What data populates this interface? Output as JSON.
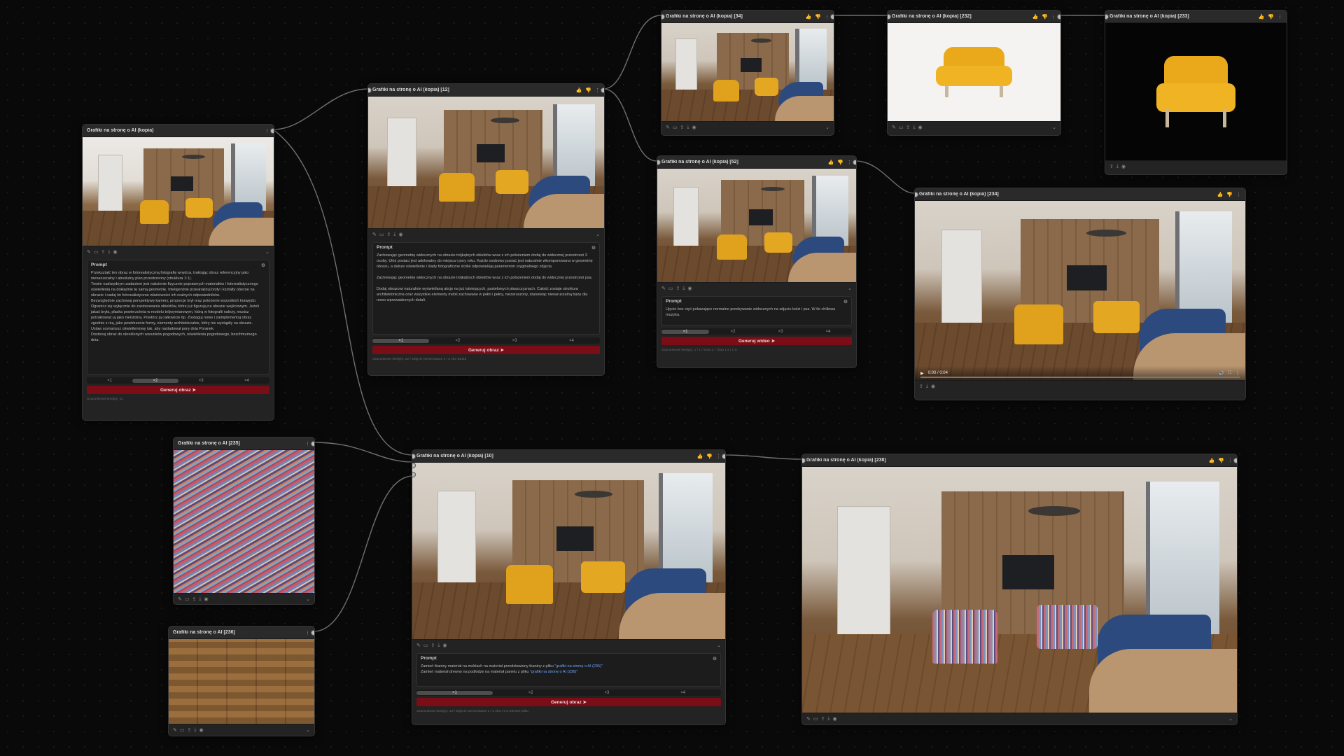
{
  "nodes": {
    "n1": {
      "title": "Grafiki na stronę o AI (kopia)",
      "prompt_label": "Prompt",
      "prompt_text": "Przekształć ten obraz w fotorealistyczną fotografię wnętrza, traktując obraz referencyjny jako nienaruszalny i absolutny plan przestrzenny (struktura 1:1).\nTwoim nadrzędnym zadaniem jest nałożenie fizycznie poprawnych materiałów i fotorealistycznego oświetlenia na dokładnie tę samą geometrię. Inteligentnie przeanalizuj bryły i kształty obecne na obrazie i nadaj im fotorealistyczne właściwości ich realnych odpowiedników.\nBezwzględnie zachowaj perspektywę kamery, proporcje brył oraz położenie wszystkich krawędzi. Ogranicz się wyłącznie do zastosowania obiektów, które już figurują na obrazie wejściowym. Jeżeli jakaś bryła, płaska powierzchnia w modelu trójwymiarowym, którą w fotografii należy, musisz potraktować ją jako nieistotną. Powtórz ją całkowicie itp. Zredaguj nowe i zaimplementuj obraz zgodnie z nią, jako powtórzenie formy, elementy architekturalne, który nie wystąpiły na obrazie.\nUstaw scenariusz oświetleniowy tak, aby naśladował porę dnia Poranek.\nDostosuj obraz do określonych warunków pogodowych, oświetlenia pogodowego, bezchmurnego dnia.",
      "counts": [
        "×1",
        "×2",
        "×3",
        "×4"
      ],
      "selected": 1,
      "gen_label": "Generuj obraz",
      "footer": "Szacunkowe kredyty: 11"
    },
    "n2": {
      "title": "Grafiki na stronę o AI (kopia) [12]",
      "prompt_label": "Prompt",
      "prompt_text": "Zachowując geometrię widocznych na obrazie trójkątnych obiektów wraz z ich położeniem dodaj do widocznej przestrzeni 3 osoby. Ułóż postaci jest adekwatny do miejsca i pory roku. Każdo osobowo postać jest naturalnie wkomponowana w geometrię obrazu, a dalsze oświetlenie i ślady fotograficzne ściśle odpowiadają parametrom oryginalnego zdjęcia.\n\nZachowując geometrię widocznych na obrazie trójkątnych obiektów wraz z ich położeniem dodaj do widocznej przestrzeni psa.\n\nDodaj obrazowi naturalnie wyświetlaną akcję na już istniejących, pastelowych płaszczyznach. Całość zostaje struktura architektoniczna oraz wszystkie elementy mebli zachowane w pełni i pełny, niezaruszony, stanowiąc nienaruszalną bazę dla nowo wprowadzonych detali.",
      "counts": [
        "×1",
        "×2",
        "×3",
        "×4"
      ],
      "selected": 0,
      "gen_label": "Generuj obraz",
      "footer": "Szacunkowe kredyty: 22 / Zdjęcie Generowane 3 / 2 Alto Budut"
    },
    "n34": {
      "title": "Grafiki na stronę o AI (kopia) [34]"
    },
    "n232": {
      "title": "Grafiki na stronę o AI (kopia) [232]"
    },
    "n233": {
      "title": "Grafiki na stronę o AI (kopia) [233]"
    },
    "n52": {
      "title": "Grafiki na stronę o AI (kopia) [52]",
      "prompt_label": "Prompt",
      "prompt_text": "Ujęcie bez cięć pokazujące normalne przebywanie widocznych na zdjęciu ludzi i psa. W tle chillowa muzyka.",
      "counts": [
        "×1",
        "×2",
        "×3",
        "×4"
      ],
      "selected": 0,
      "gen_label": "Generuj wideo",
      "footer": "Szacunkowe kredyty: 1 / 1 / Sora 2 / 720p 1 s / 1 S"
    },
    "n234": {
      "title": "Grafiki na stronę o AI (kopia) [234]",
      "video_time": "0:00 / 0:04"
    },
    "n235": {
      "title": "Grafiki na stronę o AI [235]"
    },
    "n236": {
      "title": "Grafiki na stronę o AI [236]"
    },
    "n10": {
      "title": "Grafiki na stronę o AI (kopia) [10]",
      "prompt_label": "Prompt",
      "prompt_line1": "Zamień tkaniny materiał na meblach na materiał przedstawiony tkaniny z pliku ",
      "prompt_link1": "\"grafiki na stronę o AI (235)\"",
      "prompt_line2": "Zamień materiał drewno na podłodze na materiał panelu z pliku ",
      "prompt_link2": "\"grafiki na stronę o AI (236)\"",
      "counts": [
        "×1",
        "×2",
        "×3",
        "×4"
      ],
      "selected": 0,
      "gen_label": "Generuj obraz",
      "footer": "Szacunkowe kredyty: 14 / Zdjęcie Generowane 1 / 2 Alto / 2 a wiersze pliku"
    },
    "n238": {
      "title": "Grafiki na stronę o AI (kopia) [238]"
    }
  },
  "icons": [
    "pencil-icon",
    "crop-icon",
    "share-icon",
    "download-icon",
    "eye-icon",
    "chevron-icon",
    "like-icon",
    "dislike-icon",
    "menu-icon",
    "gear-icon",
    "play-icon",
    "volume-icon",
    "fullscreen-icon"
  ],
  "colors": {
    "background": "#090909",
    "node": "#232323",
    "accent": "#7a0d16",
    "link": "#6fa4ff"
  }
}
